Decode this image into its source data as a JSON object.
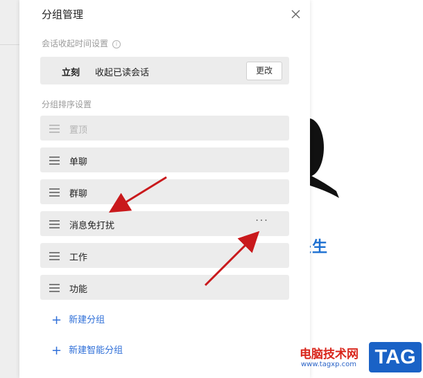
{
  "dialog": {
    "title": "分组管理",
    "close_icon": "close-icon"
  },
  "collapse_section": {
    "label": "会话收起时间设置",
    "info_glyph": "i",
    "time": "立刻",
    "description": "收起已读会话",
    "change_button": "更改"
  },
  "sort_section": {
    "label": "分组排序设置",
    "groups": [
      {
        "label": "置顶",
        "disabled": true
      },
      {
        "label": "单聊"
      },
      {
        "label": "群聊"
      },
      {
        "label": "消息免打扰",
        "more": "···"
      },
      {
        "label": "工作"
      },
      {
        "label": "功能"
      }
    ]
  },
  "actions": {
    "new_group": "新建分组",
    "new_smart_group": "新建智能分组",
    "plus_glyph": "+"
  },
  "background": {
    "partial_text": "关生"
  },
  "watermark": {
    "title": "电脑技术网",
    "url": "www.tagxp.com",
    "tag": "TAG"
  },
  "colors": {
    "accent": "#2f6fd8",
    "annotation_arrow": "#c9191c",
    "row_bg": "#ececec"
  }
}
